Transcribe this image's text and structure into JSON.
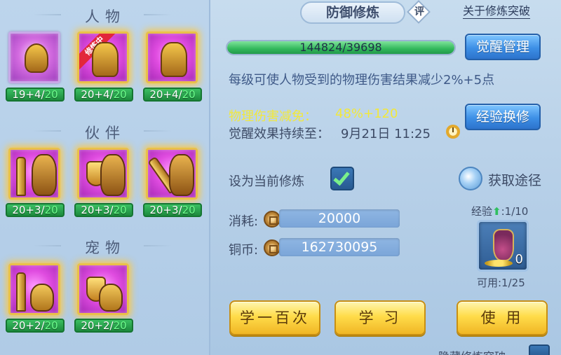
{
  "sections": {
    "characters": "人物",
    "partners": "伙伴",
    "pets": "宠物"
  },
  "cards": {
    "characters": [
      {
        "level_base": "19",
        "level_bonus": "+4/",
        "level_cap": "20",
        "icon": "warrior-meditating",
        "training": false
      },
      {
        "level_base": "20",
        "level_bonus": "+4/",
        "level_cap": "20",
        "icon": "warrior-armor",
        "training": true,
        "ribbon": "修炼中"
      },
      {
        "level_base": "20",
        "level_bonus": "+4/",
        "level_cap": "20",
        "icon": "warrior-standing",
        "training": false
      }
    ],
    "partners": [
      {
        "level_base": "20",
        "level_bonus": "+3/",
        "level_cap": "20",
        "icon": "sword-beast"
      },
      {
        "level_base": "20",
        "level_bonus": "+3/",
        "level_cap": "20",
        "icon": "shield-beast"
      },
      {
        "level_base": "20",
        "level_bonus": "+3/",
        "level_cap": "20",
        "icon": "gauntlet-beast"
      }
    ],
    "pets": [
      {
        "level_base": "20",
        "level_bonus": "+2/",
        "level_cap": "20",
        "icon": "sword-cat"
      },
      {
        "level_base": "20",
        "level_bonus": "+2/",
        "level_cap": "20",
        "icon": "shield-cat"
      }
    ]
  },
  "header": {
    "title": "防御修炼",
    "rate": "评",
    "help_link": "关于修炼突破"
  },
  "exp_bar": {
    "text": "144824/39698",
    "fill_fraction": 1.0
  },
  "buttons": {
    "awaken_manage": "觉醒管理",
    "exp_exchange": "经验换修",
    "learn_hundred": "学一百次",
    "learn": "学 习",
    "use": "使 用"
  },
  "description": "每级可使人物受到的物理伤害结果减少2%+5点",
  "stats": {
    "physical_label": "物理伤害减免：",
    "physical_value": "48%+120",
    "awaken_label": "觉醒效果持续至：",
    "awaken_value": "9月21日 11:25"
  },
  "set_current": {
    "label": "设为当前修炼",
    "checked": true
  },
  "acquire": {
    "label": "获取途径"
  },
  "cost": {
    "label": "消耗:",
    "value": "20000"
  },
  "copper": {
    "label": "铜币:",
    "value": "162730095"
  },
  "item": {
    "exp_prefix": "经验",
    "exp_suffix": ":1/10",
    "count": "0",
    "usable": "可用:1/25"
  },
  "bottom": {
    "label": "隐藏修炼突破"
  },
  "colors": {
    "accent_gold": "#ffdc4a",
    "accent_blue": "#3d8fe6",
    "stat_yellow": "#f2e83b",
    "card_purple": "#e04ce0",
    "level_green": "#1c8a3d"
  }
}
